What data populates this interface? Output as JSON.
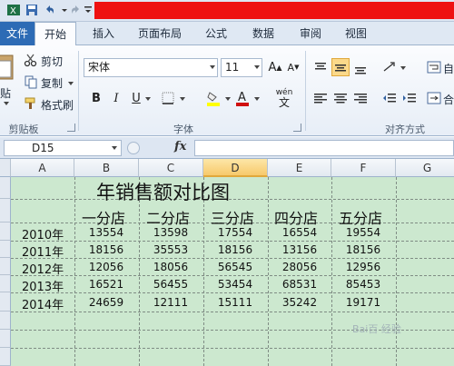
{
  "ribbon": {
    "tabs": [
      "文件",
      "开始",
      "插入",
      "页面布局",
      "公式",
      "数据",
      "审阅",
      "视图"
    ],
    "clipboard": {
      "paste": "贴",
      "cut": "剪切",
      "copy": "复制",
      "format_painter": "格式刷",
      "group": "剪贴板"
    },
    "font": {
      "name": "宋体",
      "size": "11",
      "bold": "B",
      "italic": "I",
      "underline": "U",
      "wen": "wén",
      "wen2": "文",
      "group": "字体"
    },
    "alignment": {
      "group": "对齐方式",
      "wrap": "自",
      "merge": "合"
    }
  },
  "formula_bar": {
    "name_box": "D15",
    "fx": "fx",
    "value": ""
  },
  "sheet": {
    "columns": [
      "A",
      "B",
      "C",
      "D",
      "E",
      "F",
      "G"
    ],
    "selected_column": "D",
    "title": "年销售额对比图",
    "store_headers": [
      "一分店",
      "二分店",
      "三分店",
      "四分店",
      "五分店"
    ],
    "rows": [
      {
        "year": "2010年",
        "values": [
          "13554",
          "13598",
          "17554",
          "16554",
          "19554"
        ]
      },
      {
        "year": "2011年",
        "values": [
          "18156",
          "35553",
          "18156",
          "13156",
          "18156"
        ]
      },
      {
        "year": "2012年",
        "values": [
          "12056",
          "18056",
          "56545",
          "28056",
          "12956"
        ]
      },
      {
        "year": "2013年",
        "values": [
          "16521",
          "56455",
          "53454",
          "68531",
          "85453"
        ]
      },
      {
        "year": "2014年",
        "values": [
          "24659",
          "12111",
          "15111",
          "35242",
          "19171"
        ]
      }
    ]
  },
  "watermark": "Bai百 经验",
  "colors": {
    "grid_bg": "#cce8cf",
    "file_tab": "#2d6bb5",
    "red_bar": "#ee1111"
  }
}
